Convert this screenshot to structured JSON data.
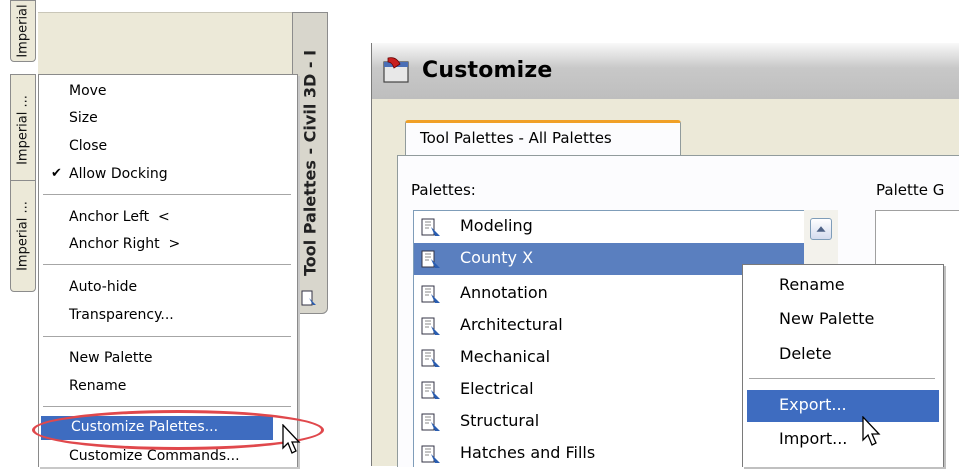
{
  "left_panel": {
    "side_tabs": [
      "Imperial",
      "Imperial ...",
      "Imperial ..."
    ],
    "title_strip": "Tool Palettes - Civil 3D - I",
    "menu": {
      "items": [
        {
          "label": "Move"
        },
        {
          "label": "Size"
        },
        {
          "label": "Close"
        },
        {
          "label": "Allow Docking",
          "checked": true
        },
        {
          "label": "Anchor Left  <"
        },
        {
          "label": "Anchor Right  >"
        },
        {
          "label": "Auto-hide"
        },
        {
          "label": "Transparency..."
        },
        {
          "label": "New Palette"
        },
        {
          "label": "Rename"
        },
        {
          "label": "Customize Palettes...",
          "highlighted": true
        },
        {
          "label": "Customize Commands..."
        }
      ],
      "check_glyph": "✔"
    },
    "highlight_color": "#e0484c"
  },
  "dialog": {
    "title": "Customize",
    "tab": "Tool Palettes - All Palettes",
    "palettes_label": "Palettes:",
    "groups_label": "Palette G",
    "palettes": [
      {
        "name": "Modeling"
      },
      {
        "name": "County X",
        "selected": true
      },
      {
        "name": "Annotation"
      },
      {
        "name": "Architectural"
      },
      {
        "name": "Mechanical"
      },
      {
        "name": "Electrical"
      },
      {
        "name": "Structural"
      },
      {
        "name": "Hatches and Fills"
      }
    ],
    "context_menu": {
      "items": [
        {
          "label": "Rename"
        },
        {
          "label": "New Palette"
        },
        {
          "label": "Delete"
        },
        {
          "label": "Export...",
          "highlighted": true
        },
        {
          "label": "Import..."
        }
      ]
    },
    "selection_color": "#3e6cc0"
  }
}
